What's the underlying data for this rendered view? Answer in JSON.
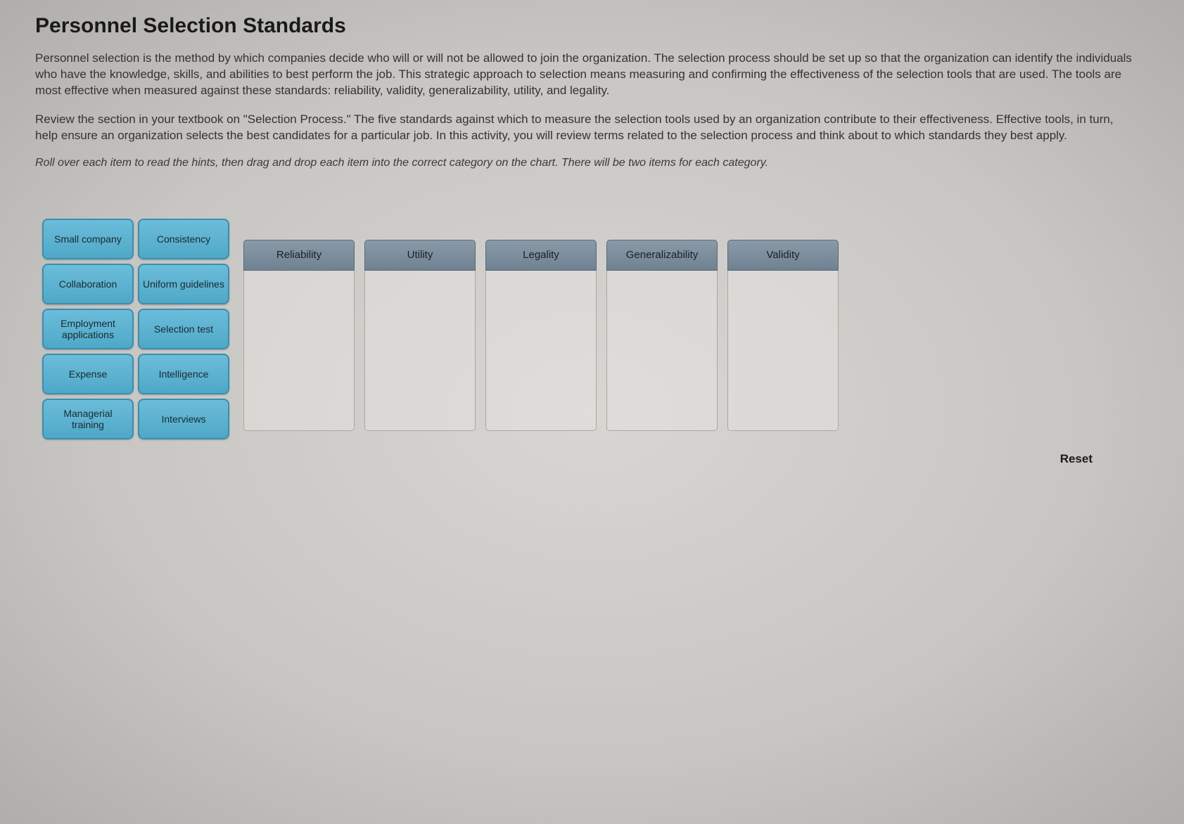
{
  "title": "Personnel Selection Standards",
  "paragraph1": "Personnel selection is the method by which companies decide who will or will not be allowed to join the organization. The selection process should be set up so that the organization can identify the individuals who have the knowledge, skills, and abilities to best perform the job. This strategic approach to selection means measuring and confirming the effectiveness of the selection tools that are used. The tools are most effective when measured against these standards: reliability, validity, generalizability, utility, and legality.",
  "paragraph2": "Review the section in your textbook on \"Selection Process.\" The five standards against which to measure the selection tools used by an organization contribute to their effectiveness. Effective tools, in turn, help ensure an organization selects the best candidates for a particular job. In this activity, you will review terms related to the selection process and think about to which standards they best apply.",
  "instruction": "Roll over each item to read the hints, then drag and drop each item into the correct category on the chart. There will be two items for each category.",
  "items": [
    {
      "label": "Small company"
    },
    {
      "label": "Consistency"
    },
    {
      "label": "Collaboration"
    },
    {
      "label": "Uniform guidelines"
    },
    {
      "label": "Employment applications"
    },
    {
      "label": "Selection test"
    },
    {
      "label": "Expense"
    },
    {
      "label": "Intelligence"
    },
    {
      "label": "Managerial training"
    },
    {
      "label": "Interviews"
    }
  ],
  "categories": [
    {
      "label": "Reliability"
    },
    {
      "label": "Utility"
    },
    {
      "label": "Legality"
    },
    {
      "label": "Generalizability"
    },
    {
      "label": "Validity"
    }
  ],
  "reset_label": "Reset"
}
